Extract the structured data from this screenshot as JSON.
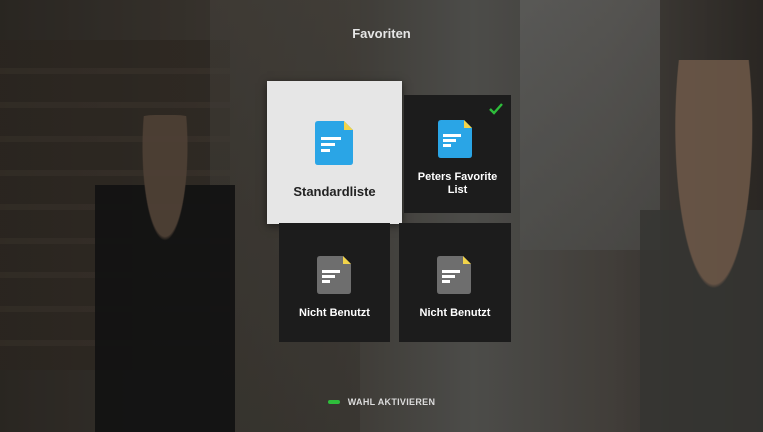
{
  "header": {
    "title": "Favoriten"
  },
  "tiles": [
    {
      "label": "Standardliste",
      "icon": "document-icon",
      "icon_color": "#2aa5e6",
      "focused": true,
      "selected": false
    },
    {
      "label": "Peters Favorite List",
      "icon": "document-icon",
      "icon_color": "#2aa5e6",
      "focused": false,
      "selected": true
    },
    {
      "label": "Nicht Benutzt",
      "icon": "document-icon",
      "icon_color": "#6e6e6e",
      "focused": false,
      "selected": false
    },
    {
      "label": "Nicht Benutzt",
      "icon": "document-icon",
      "icon_color": "#6e6e6e",
      "focused": false,
      "selected": false
    }
  ],
  "footer": {
    "action_label": "WAHL AKTIVIEREN",
    "key_color": "#2ebd3b",
    "key_icon": "green-key-icon"
  },
  "colors": {
    "accent_blue": "#2aa5e6",
    "inactive_gray": "#6e6e6e",
    "fold_yellow": "#f2d44a",
    "check_green": "#2ebd3b"
  }
}
